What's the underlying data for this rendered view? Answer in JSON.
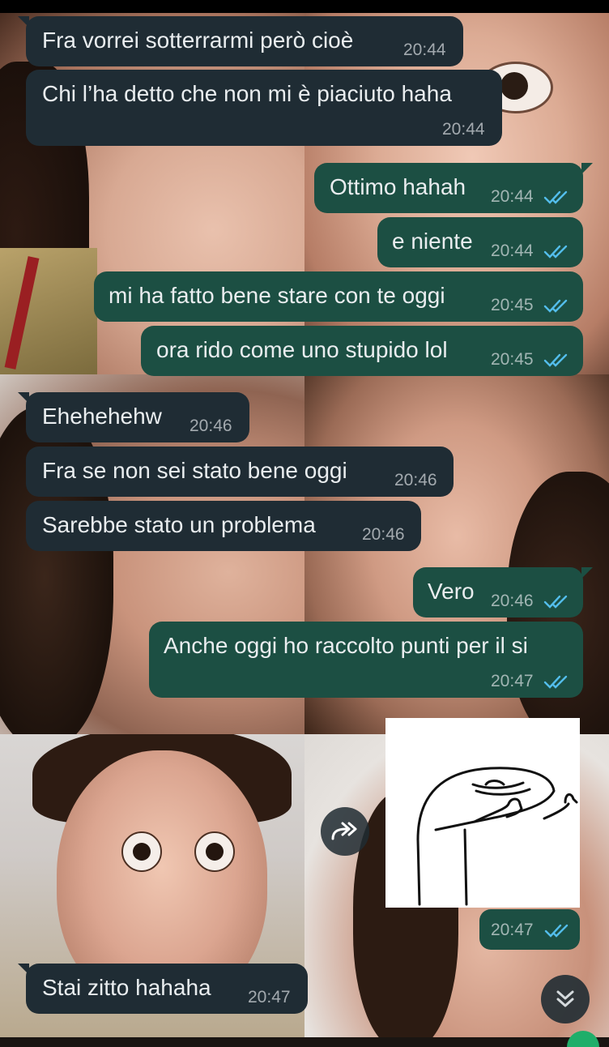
{
  "messages": [
    {
      "dir": "in",
      "text": "Fra vorrei sotterrarmi però cioè",
      "time": "20:44"
    },
    {
      "dir": "in",
      "text": "Chi l’ha detto che non mi è piaciuto haha",
      "time": "20:44"
    },
    {
      "dir": "out",
      "text": "Ottimo hahah",
      "time": "20:44",
      "status": "read"
    },
    {
      "dir": "out",
      "text": "e niente",
      "time": "20:44",
      "status": "read"
    },
    {
      "dir": "out",
      "text": "mi ha fatto bene stare con te oggi",
      "time": "20:45",
      "status": "read"
    },
    {
      "dir": "out",
      "text": "ora rido come uno stupido lol",
      "time": "20:45",
      "status": "read"
    },
    {
      "dir": "in",
      "text": "Ehehehehw",
      "time": "20:46"
    },
    {
      "dir": "in",
      "text": "Fra se non sei stato bene oggi",
      "time": "20:46"
    },
    {
      "dir": "in",
      "text": "Sarebbe stato un problema",
      "time": "20:46"
    },
    {
      "dir": "out",
      "text": "Vero",
      "time": "20:46",
      "status": "read"
    },
    {
      "dir": "out",
      "text": "Anche oggi ho raccolto punti per il si",
      "time": "20:47",
      "status": "read"
    },
    {
      "dir": "in",
      "text": "Stai zitto hahaha",
      "time": "20:47"
    }
  ],
  "sticker": {
    "time": "20:47",
    "status": "read",
    "icon": "sticker-meme-thumbs-up"
  },
  "controls": {
    "forward_icon": "forward-icon",
    "scroll_icon": "scroll-down-icon"
  },
  "colors": {
    "incoming": "#1f2c34",
    "outgoing": "#1c4f43",
    "read_ticks": "#53bdeb",
    "text": "#e9edef"
  }
}
